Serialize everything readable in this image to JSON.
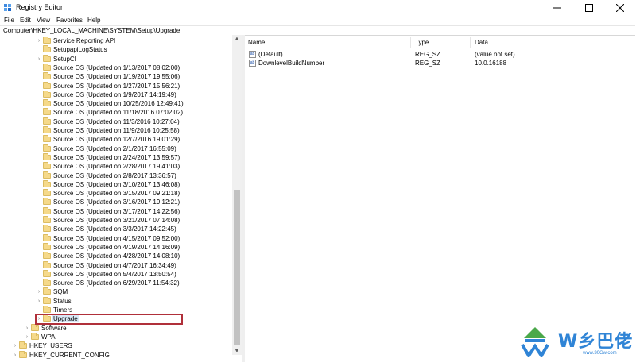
{
  "window": {
    "title": "Registry Editor",
    "minimize_icon": "minimize-icon",
    "maximize_icon": "maximize-icon",
    "close_icon": "close-icon"
  },
  "menu": [
    "File",
    "Edit",
    "View",
    "Favorites",
    "Help"
  ],
  "address": "Computer\\HKEY_LOCAL_MACHINE\\SYSTEM\\Setup\\Upgrade",
  "tree": {
    "items": [
      {
        "label": "Service Reporting API",
        "expand": true
      },
      {
        "label": "SetupapiLogStatus",
        "expand": false
      },
      {
        "label": "SetupCI",
        "expand": true
      },
      {
        "label": "Source OS (Updated on 1/13/2017 08:02:00)",
        "expand": false
      },
      {
        "label": "Source OS (Updated on 1/19/2017 19:55:06)",
        "expand": false
      },
      {
        "label": "Source OS (Updated on 1/27/2017 15:56:21)",
        "expand": false
      },
      {
        "label": "Source OS (Updated on 1/9/2017 14:19:49)",
        "expand": false
      },
      {
        "label": "Source OS (Updated on 10/25/2016 12:49:41)",
        "expand": false
      },
      {
        "label": "Source OS (Updated on 11/18/2016 07:02:02)",
        "expand": false
      },
      {
        "label": "Source OS (Updated on 11/3/2016 10:27:04)",
        "expand": false
      },
      {
        "label": "Source OS (Updated on 11/9/2016 10:25:58)",
        "expand": false
      },
      {
        "label": "Source OS (Updated on 12/7/2016 19:01:29)",
        "expand": false
      },
      {
        "label": "Source OS (Updated on 2/1/2017 16:55:09)",
        "expand": false
      },
      {
        "label": "Source OS (Updated on 2/24/2017 13:59:57)",
        "expand": false
      },
      {
        "label": "Source OS (Updated on 2/28/2017 19:41:03)",
        "expand": false
      },
      {
        "label": "Source OS (Updated on 2/8/2017 13:36:57)",
        "expand": false
      },
      {
        "label": "Source OS (Updated on 3/10/2017 13:46:08)",
        "expand": false
      },
      {
        "label": "Source OS (Updated on 3/15/2017 09:21:18)",
        "expand": false
      },
      {
        "label": "Source OS (Updated on 3/16/2017 19:12:21)",
        "expand": false
      },
      {
        "label": "Source OS (Updated on 3/17/2017 14:22:56)",
        "expand": false
      },
      {
        "label": "Source OS (Updated on 3/21/2017 07:14:08)",
        "expand": false
      },
      {
        "label": "Source OS (Updated on 3/3/2017 14:22:45)",
        "expand": false
      },
      {
        "label": "Source OS (Updated on 4/15/2017 09:52:00)",
        "expand": false
      },
      {
        "label": "Source OS (Updated on 4/19/2017 14:16:09)",
        "expand": false
      },
      {
        "label": "Source OS (Updated on 4/28/2017 14:08:10)",
        "expand": false
      },
      {
        "label": "Source OS (Updated on 4/7/2017 16:34:49)",
        "expand": false
      },
      {
        "label": "Source OS (Updated on 5/4/2017 13:50:54)",
        "expand": false
      },
      {
        "label": "Source OS (Updated on 6/29/2017 11:54:32)",
        "expand": false
      },
      {
        "label": "SQM",
        "expand": true
      },
      {
        "label": "Status",
        "expand": true
      },
      {
        "label": "Timers",
        "expand": false
      },
      {
        "label": "Upgrade",
        "expand": true,
        "selected": true
      },
      {
        "label": "Software",
        "expand": true,
        "level": 1
      },
      {
        "label": "WPA",
        "expand": true,
        "level": 1
      },
      {
        "label": "HKEY_USERS",
        "expand": true,
        "level": 0
      },
      {
        "label": "HKEY_CURRENT_CONFIG",
        "expand": true,
        "level": 0
      }
    ]
  },
  "values": {
    "columns": [
      "Name",
      "Type",
      "Data"
    ],
    "rows": [
      {
        "name": "(Default)",
        "type": "REG_SZ",
        "data": "(value not set)"
      },
      {
        "name": "DownlevelBuildNumber",
        "type": "REG_SZ",
        "data": "10.0.16188"
      }
    ]
  },
  "watermark": {
    "text": "W乡巴佬",
    "subtext": "www.30Gw.com"
  },
  "colors": {
    "highlight": "#b0303a",
    "folder": "#f5d98a",
    "watermark": "#2f84d6"
  }
}
